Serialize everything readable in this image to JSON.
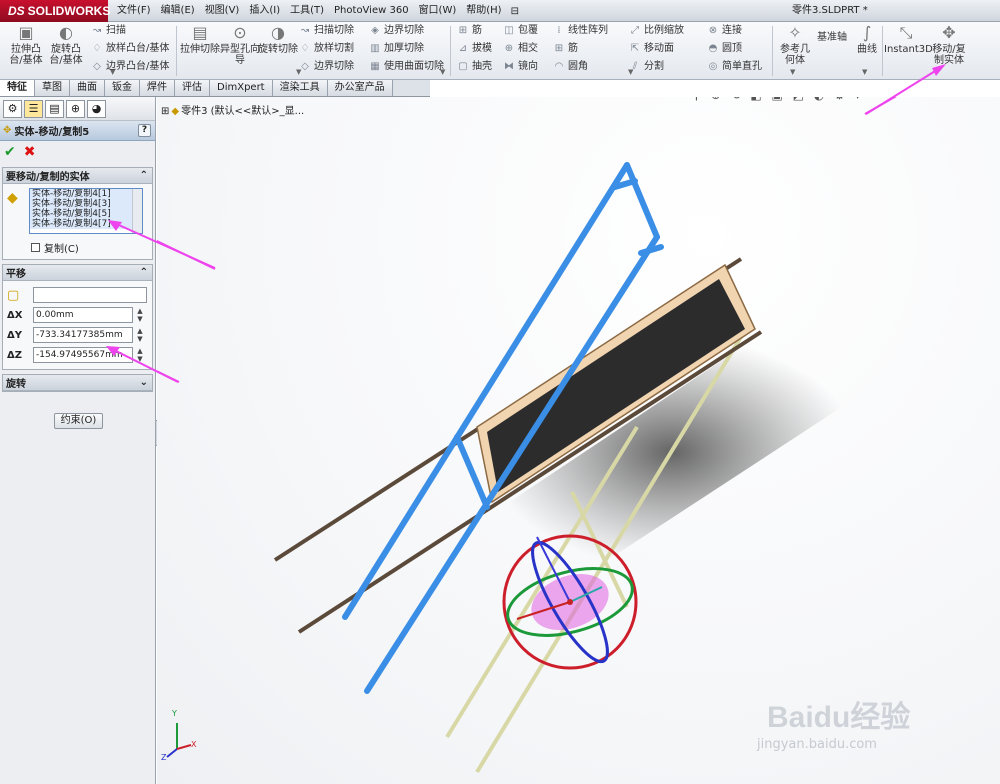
{
  "app": {
    "brand": "SOLIDWORKS",
    "brand_prefix": "DS",
    "document_title": "零件3.SLDPRT *"
  },
  "menus": [
    "文件(F)",
    "编辑(E)",
    "视图(V)",
    "插入(I)",
    "工具(T)",
    "PhotoView 360",
    "窗口(W)",
    "帮助(H)"
  ],
  "toolbar": {
    "boss_extrude": "拉伸凸台/基体",
    "revolve_boss": "旋转凸台/基体",
    "sweep": "扫描",
    "loft": "放样凸台/基体",
    "boundary_boss": "边界凸台/基体",
    "cut_extrude": "拉伸切除",
    "hole_wizard": "异型孔向导",
    "revolve_cut": "旋转切除",
    "swept_cut": "扫描切除",
    "lofted_cut": "放样切割",
    "boundary_cut": "边界切除",
    "boundary_cut2": "边界切除",
    "thicken_cut": "加厚切除",
    "surface_cut": "使用曲面切除",
    "rib": "筋",
    "wrap": "包覆",
    "linear_pattern": "线性阵列",
    "draft": "拔模",
    "intersect": "相交",
    "rib2": "筋",
    "shell": "抽壳",
    "mirror": "镜向",
    "fillet": "圆角",
    "scale": "比例缩放",
    "move_face": "移动面",
    "split": "分割",
    "join": "连接",
    "dome": "圆顶",
    "simple_hole": "简单直孔",
    "ref_geometry": "参考几何体",
    "curves_axis": "基准轴",
    "curves": "曲线",
    "instant3d": "Instant3D",
    "move_copy": "移动/复制实体"
  },
  "tabs": [
    "特征",
    "草图",
    "曲面",
    "钣金",
    "焊件",
    "评估",
    "DimXpert",
    "渲染工具",
    "办公室产品"
  ],
  "property_manager": {
    "title": "实体-移动/复制5",
    "bodies_group": "要移动/复制的实体",
    "bodies": [
      "实体-移动/复制4[1]",
      "实体-移动/复制4[3]",
      "实体-移动/复制4[5]",
      "实体-移动/复制4[7]"
    ],
    "copy_label": "复制(C)",
    "translate_group": "平移",
    "translate_ref": "",
    "dx_label": "ΔX",
    "dx": "0.00mm",
    "dy_label": "ΔY",
    "dy": "-733.34177385mm",
    "dz_label": "ΔZ",
    "dz": "-154.97495567mm",
    "rotate_group": "旋转",
    "constraint_button": "约束(O)"
  },
  "tree": {
    "root": "零件3 (默认<<默认>_显..."
  },
  "triad": {
    "x": "X",
    "y": "Y",
    "z": "Z"
  },
  "watermark": {
    "text": "Baidu经验",
    "url": "jingyan.baidu.com"
  },
  "colors": {
    "selected_body": "#3a8ee6",
    "arrow": "#ee44ee",
    "titlebar_red": "#c8102e"
  }
}
